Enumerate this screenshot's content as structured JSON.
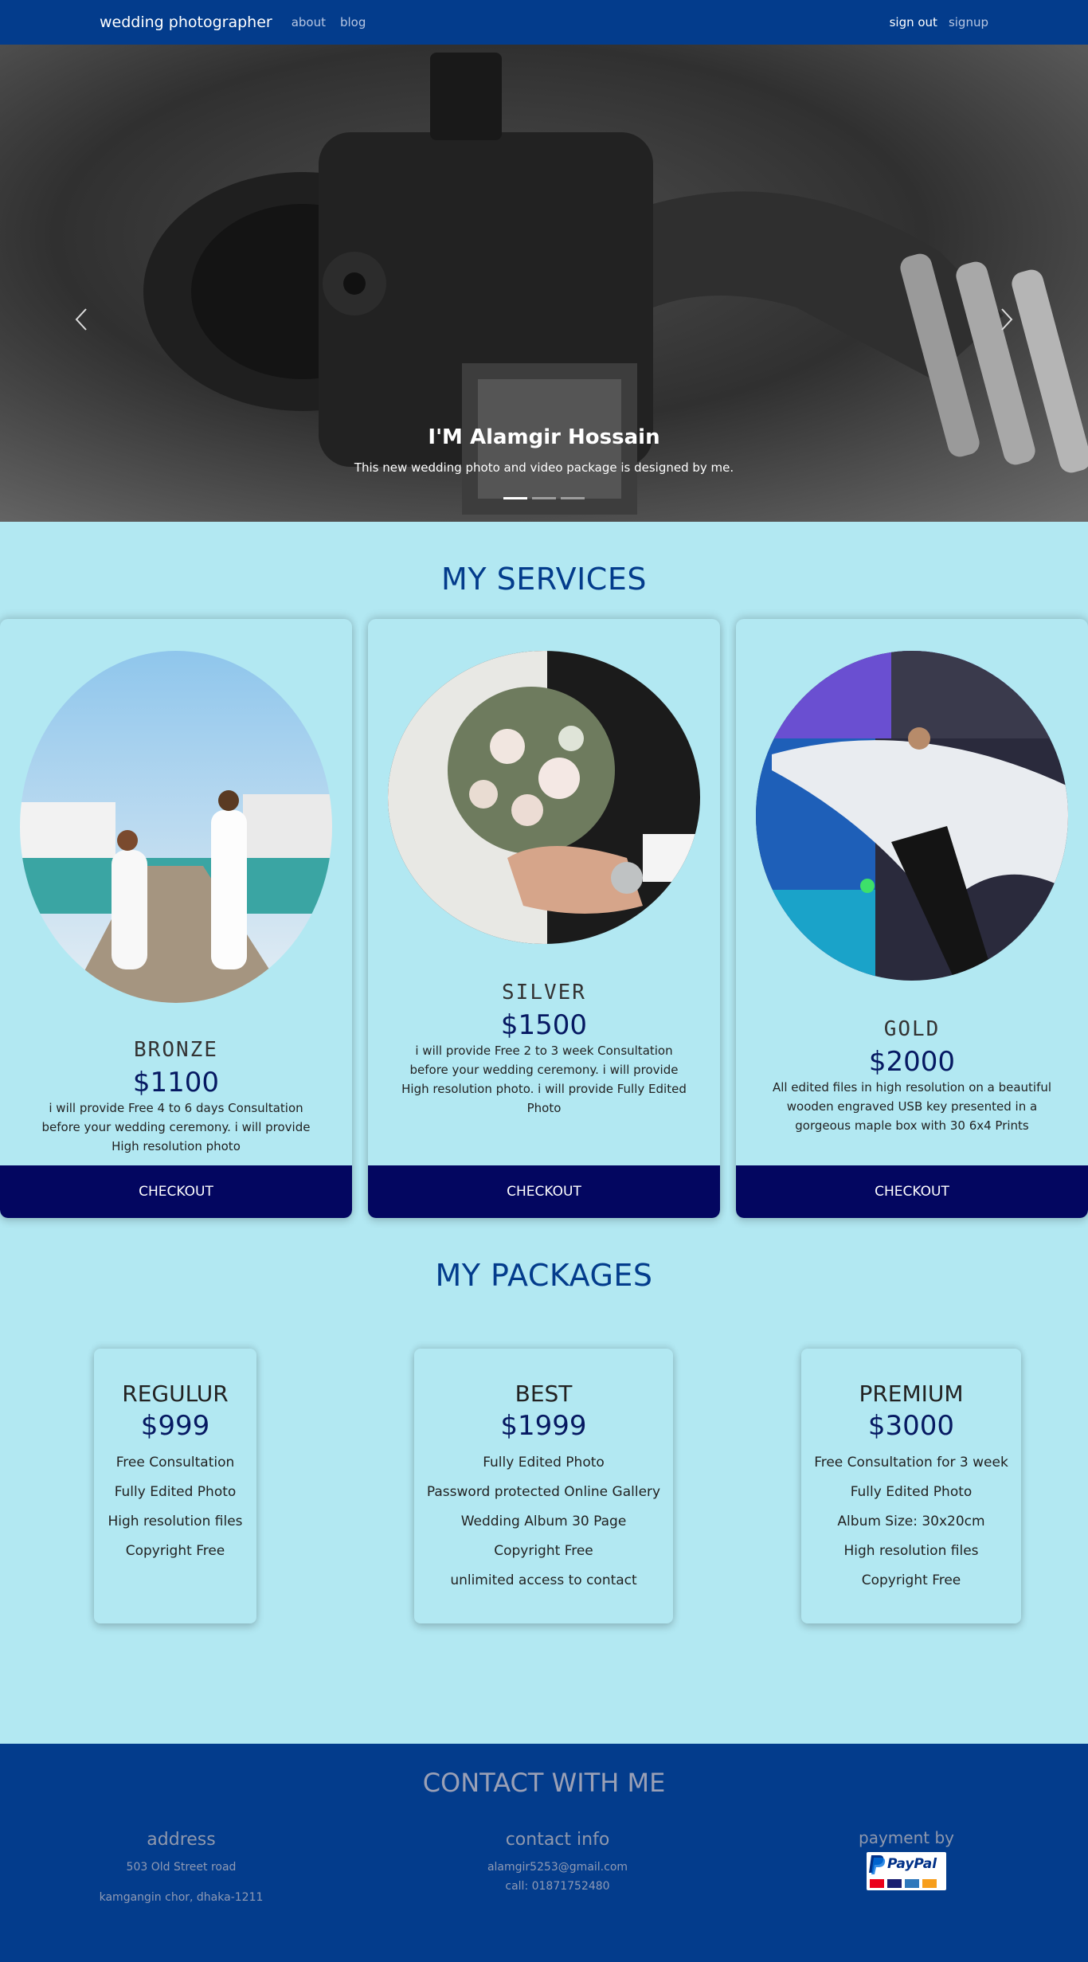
{
  "navbar": {
    "brand": "wedding photographer",
    "links": [
      "about",
      "blog"
    ],
    "signout": "sign out",
    "signup": "signup"
  },
  "hero": {
    "title": "I'M Alamgir Hossain",
    "subtitle": "This new wedding photo and video package is designed by me.",
    "slides": 3,
    "active_slide": 1
  },
  "services": {
    "title": "MY SERVICES",
    "cards": [
      {
        "name": "BRONZE",
        "price": "$1100",
        "desc": "i will provide Free 4 to 6 days Consultation before your wedding ceremony. i will provide High resolution photo",
        "button": "CHECKOUT"
      },
      {
        "name": "SILVER",
        "price": "$1500",
        "desc": "i will provide Free 2 to 3 week Consultation before your wedding ceremony. i will provide High resolution photo. i will provide Fully Edited Photo",
        "button": "CHECKOUT"
      },
      {
        "name": "GOLD",
        "price": "$2000",
        "desc": "All edited files in high resolution on a beautiful wooden engraved USB key presented in a gorgeous maple box with 30 6x4 Prints",
        "button": "CHECKOUT"
      }
    ]
  },
  "packages": {
    "title": "MY PACKAGES",
    "cards": [
      {
        "name": "REGULUR",
        "price": "$999",
        "features": [
          "Free Consultation",
          "Fully Edited Photo",
          "High resolution files",
          "Copyright Free"
        ]
      },
      {
        "name": "BEST",
        "price": "$1999",
        "features": [
          "Fully Edited Photo",
          "Password protected Online Gallery",
          "Wedding Album 30 Page",
          "Copyright Free",
          "unlimited access to contact"
        ]
      },
      {
        "name": "PREMIUM",
        "price": "$3000",
        "features": [
          "Free Consultation for 3 week",
          "Fully Edited Photo",
          "Album Size: 30x20cm",
          "High resolution files",
          "Copyright Free"
        ]
      }
    ]
  },
  "contact": {
    "title": "CONTACT WITH ME",
    "address": {
      "heading": "address",
      "line1": "503 Old Street road",
      "line2": "kamgangin chor, dhaka-1211"
    },
    "info": {
      "heading": "contact info",
      "email": "alamgir5253@gmail.com",
      "phone": "call: 01871752480"
    },
    "payment": {
      "heading": "payment by",
      "logo_text": "PayPal"
    }
  },
  "colors": {
    "navbar": "#033c8c",
    "page_bg": "#b2e8f2",
    "title": "#033c8c",
    "price": "#061962",
    "button": "#030660"
  }
}
